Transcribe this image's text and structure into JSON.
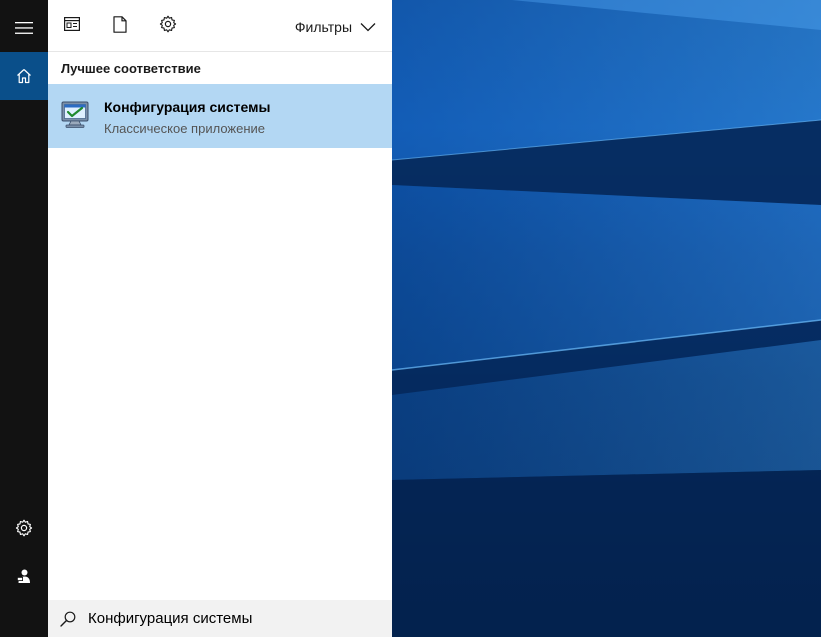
{
  "toolbar": {
    "tabs": [
      {
        "icon": "news-icon"
      },
      {
        "icon": "document-icon"
      },
      {
        "icon": "gear-icon"
      }
    ],
    "filters_label": "Фильтры"
  },
  "rail": {
    "items": [
      {
        "icon": "hamburger-icon"
      },
      {
        "icon": "home-icon",
        "active": true
      },
      {
        "icon": "gear-icon"
      },
      {
        "icon": "user-feedback-icon"
      }
    ],
    "accent": "#0a4f8a"
  },
  "results": {
    "section_title": "Лучшее соответствие",
    "best_match": {
      "title": "Конфигурация системы",
      "subtitle": "Классическое приложение",
      "icon": "system-configuration-icon",
      "highlight_color": "#b3d7f3"
    }
  },
  "search": {
    "value": "Конфигурация системы"
  }
}
